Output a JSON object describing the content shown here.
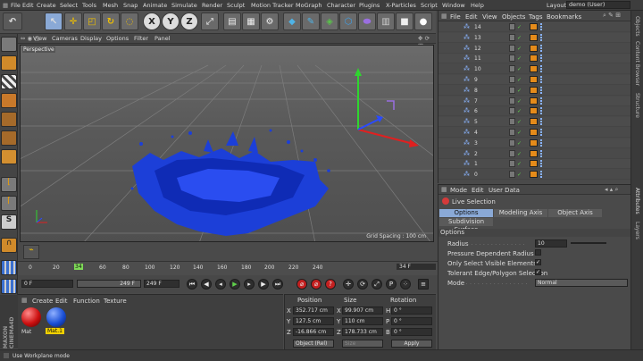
{
  "menubar": {
    "items": [
      "File",
      "Edit",
      "Create",
      "Select",
      "Tools",
      "Mesh",
      "Snap",
      "Animate",
      "Simulate",
      "Render",
      "Sculpt",
      "Motion Tracker",
      "MoGraph",
      "Character",
      "Plugins",
      "X-Particles",
      "Script",
      "Window",
      "Help"
    ],
    "layout_label": "Layout:",
    "layout_value": "demo (User)"
  },
  "viewport": {
    "menu": [
      "View",
      "Cameras",
      "Display",
      "Options",
      "Filter",
      "Panel"
    ],
    "camera_label": "Perspective",
    "grid_spacing": "Grid Spacing : 100 cm"
  },
  "timeline": {
    "ticks": [
      "0",
      "20",
      "40",
      "60",
      "80",
      "100",
      "120",
      "140",
      "160",
      "180",
      "200",
      "220",
      "240"
    ],
    "current_frame": "34",
    "end_frame": "34 F"
  },
  "transport": {
    "start_field": "0 F",
    "end_field_a": "249 F",
    "end_field_b": "249 F"
  },
  "material_manager": {
    "menu": [
      "Create",
      "Edit",
      "Function",
      "Texture"
    ],
    "materials": [
      {
        "name": "Mat",
        "color": "#cc1010"
      },
      {
        "name": "Mat.1",
        "color": "#1a4fd6"
      }
    ],
    "brand_vertical": "MAXON CINEMA4D"
  },
  "coordinates": {
    "headers": [
      "Position",
      "Size",
      "Rotation"
    ],
    "rows": [
      {
        "axis": "X",
        "pos": "352.717 cm",
        "size_axis": "X",
        "size": "99.907 cm",
        "rot_axis": "H",
        "rot": "0 °"
      },
      {
        "axis": "Y",
        "pos": "127.5 cm",
        "size_axis": "Y",
        "size": "110 cm",
        "rot_axis": "P",
        "rot": "0 °"
      },
      {
        "axis": "Z",
        "pos": "-16.866 cm",
        "size_axis": "Z",
        "size": "178.733 cm",
        "rot_axis": "B",
        "rot": "0 °"
      }
    ],
    "mode_select": "Object (Rel)",
    "size_select": "Size",
    "apply_label": "Apply"
  },
  "object_manager": {
    "menu": [
      "File",
      "Edit",
      "View",
      "Objects",
      "Tags",
      "Bookmarks"
    ],
    "objects": [
      "14",
      "13",
      "12",
      "11",
      "10",
      "9",
      "8",
      "7",
      "6",
      "5",
      "4",
      "3",
      "2",
      "1",
      "0"
    ]
  },
  "attributes": {
    "menu": [
      "Mode",
      "Edit",
      "User Data"
    ],
    "tool_name": "Live Selection",
    "tabs": [
      "Options",
      "Modeling Axis",
      "Object Axis"
    ],
    "subtab": "Subdivision Surface",
    "section": "Options",
    "radius_label": "Radius",
    "radius_value": "10",
    "pressure_label": "Pressure Dependent Radius",
    "only_visible_label": "Only Select Visible Elements",
    "tolerant_label": "Tolerant Edge/Polygon Selection",
    "mode_label": "Mode",
    "mode_value": "Normal"
  },
  "side_tabs": [
    "Objects",
    "Content Browser",
    "Structure",
    "Attributes",
    "Layers"
  ],
  "status": {
    "text": "Use Workplane mode"
  }
}
